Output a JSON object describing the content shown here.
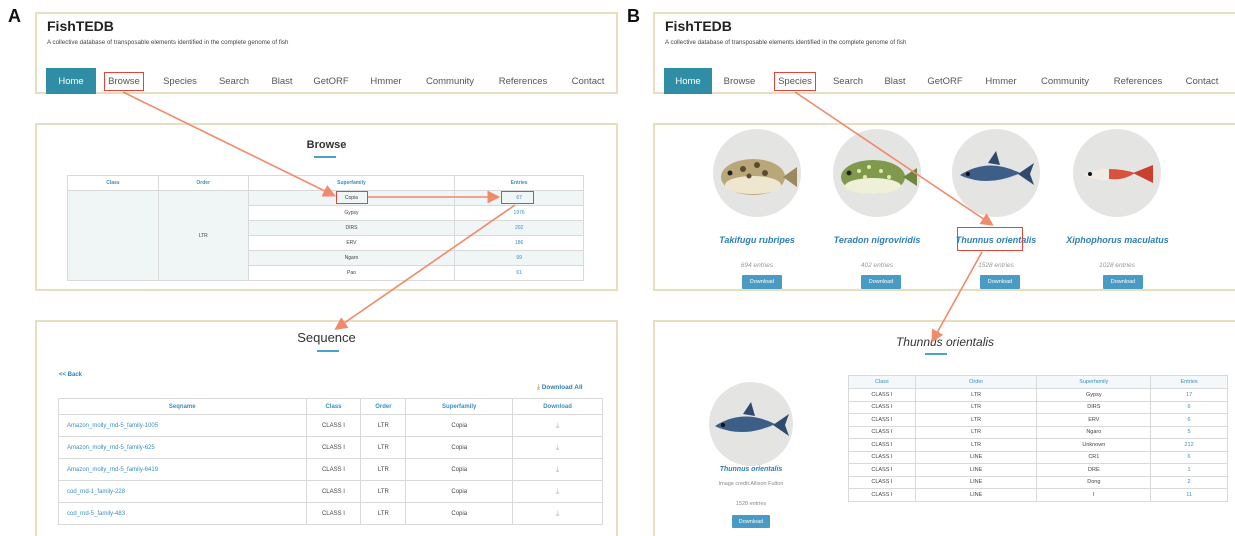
{
  "panels": {
    "a": "A",
    "b": "B"
  },
  "site": {
    "title": "FishTEDB",
    "subtitle": "A collective database of transposable elements identified in the complete genome of fish"
  },
  "nav": [
    "Home",
    "Browse",
    "Species",
    "Search",
    "Blast",
    "GetORF",
    "Hmmer",
    "Community",
    "References",
    "Contact"
  ],
  "browse": {
    "title": "Browse",
    "headers": [
      "Class",
      "Order",
      "Superfamily",
      "Entries"
    ],
    "order_value": "LTR",
    "rows": [
      {
        "superfamily": "Copia",
        "entries": "67"
      },
      {
        "superfamily": "Gypsy",
        "entries": "1976"
      },
      {
        "superfamily": "DIRS",
        "entries": "202"
      },
      {
        "superfamily": "ERV",
        "entries": "186"
      },
      {
        "superfamily": "Ngaro",
        "entries": "99"
      },
      {
        "superfamily": "Pao",
        "entries": "61"
      }
    ]
  },
  "sequence": {
    "title": "Sequence",
    "back": "<< Back",
    "download_all": "Download All",
    "headers": [
      "Seqname",
      "Class",
      "Order",
      "Superfamily",
      "Download"
    ],
    "rows": [
      {
        "name": "Amazon_molly_rnd-5_family-1005",
        "class": "CLASS I",
        "order": "LTR",
        "superfamily": "Copia"
      },
      {
        "name": "Amazon_molly_rnd-5_family-625",
        "class": "CLASS I",
        "order": "LTR",
        "superfamily": "Copia"
      },
      {
        "name": "Amazon_molly_rnd-5_family-6419",
        "class": "CLASS I",
        "order": "LTR",
        "superfamily": "Copia"
      },
      {
        "name": "cod_rnd-1_family-228",
        "class": "CLASS I",
        "order": "LTR",
        "superfamily": "Copia"
      },
      {
        "name": "cod_rnd-5_family-483",
        "class": "CLASS I",
        "order": "LTR",
        "superfamily": "Copia"
      }
    ]
  },
  "species": {
    "download_label": "Download",
    "fish": [
      {
        "name": "Takifugu rubripes",
        "entries": "694 entries"
      },
      {
        "name": "Teradon nigroviridis",
        "entries": "402 entries"
      },
      {
        "name": "Thunnus orientalis",
        "entries": "1528 entries"
      },
      {
        "name": "Xiphophorus maculatus",
        "entries": "1028 entries"
      }
    ]
  },
  "detail": {
    "title": "Thunnus orientalis",
    "name": "Thunnus orientalis",
    "credit": "Image credit:Allison Fulton",
    "entries": "1528 entries",
    "download_label": "Download",
    "headers": [
      "Class",
      "Order",
      "Superfamily",
      "Entries"
    ],
    "rows": [
      {
        "class": "CLASS I",
        "order": "LTR",
        "superfamily": "Gypsy",
        "entries": "17"
      },
      {
        "class": "CLASS I",
        "order": "LTR",
        "superfamily": "DIRS",
        "entries": "6"
      },
      {
        "class": "CLASS I",
        "order": "LTR",
        "superfamily": "ERV",
        "entries": "6"
      },
      {
        "class": "CLASS I",
        "order": "LTR",
        "superfamily": "Ngaro",
        "entries": "5"
      },
      {
        "class": "CLASS I",
        "order": "LTR",
        "superfamily": "Unknown",
        "entries": "212"
      },
      {
        "class": "CLASS I",
        "order": "LINE",
        "superfamily": "CR1",
        "entries": "6"
      },
      {
        "class": "CLASS I",
        "order": "LINE",
        "superfamily": "DRE",
        "entries": "1"
      },
      {
        "class": "CLASS I",
        "order": "LINE",
        "superfamily": "Dong",
        "entries": "2"
      },
      {
        "class": "CLASS I",
        "order": "LINE",
        "superfamily": "I",
        "entries": "11"
      }
    ]
  },
  "colors": {
    "nav_active": "#2f8ea6",
    "link": "#2f7fb5",
    "highlight": "#e0473a",
    "arrow": "#ef8a6a",
    "frame": "#e6dfbf"
  }
}
